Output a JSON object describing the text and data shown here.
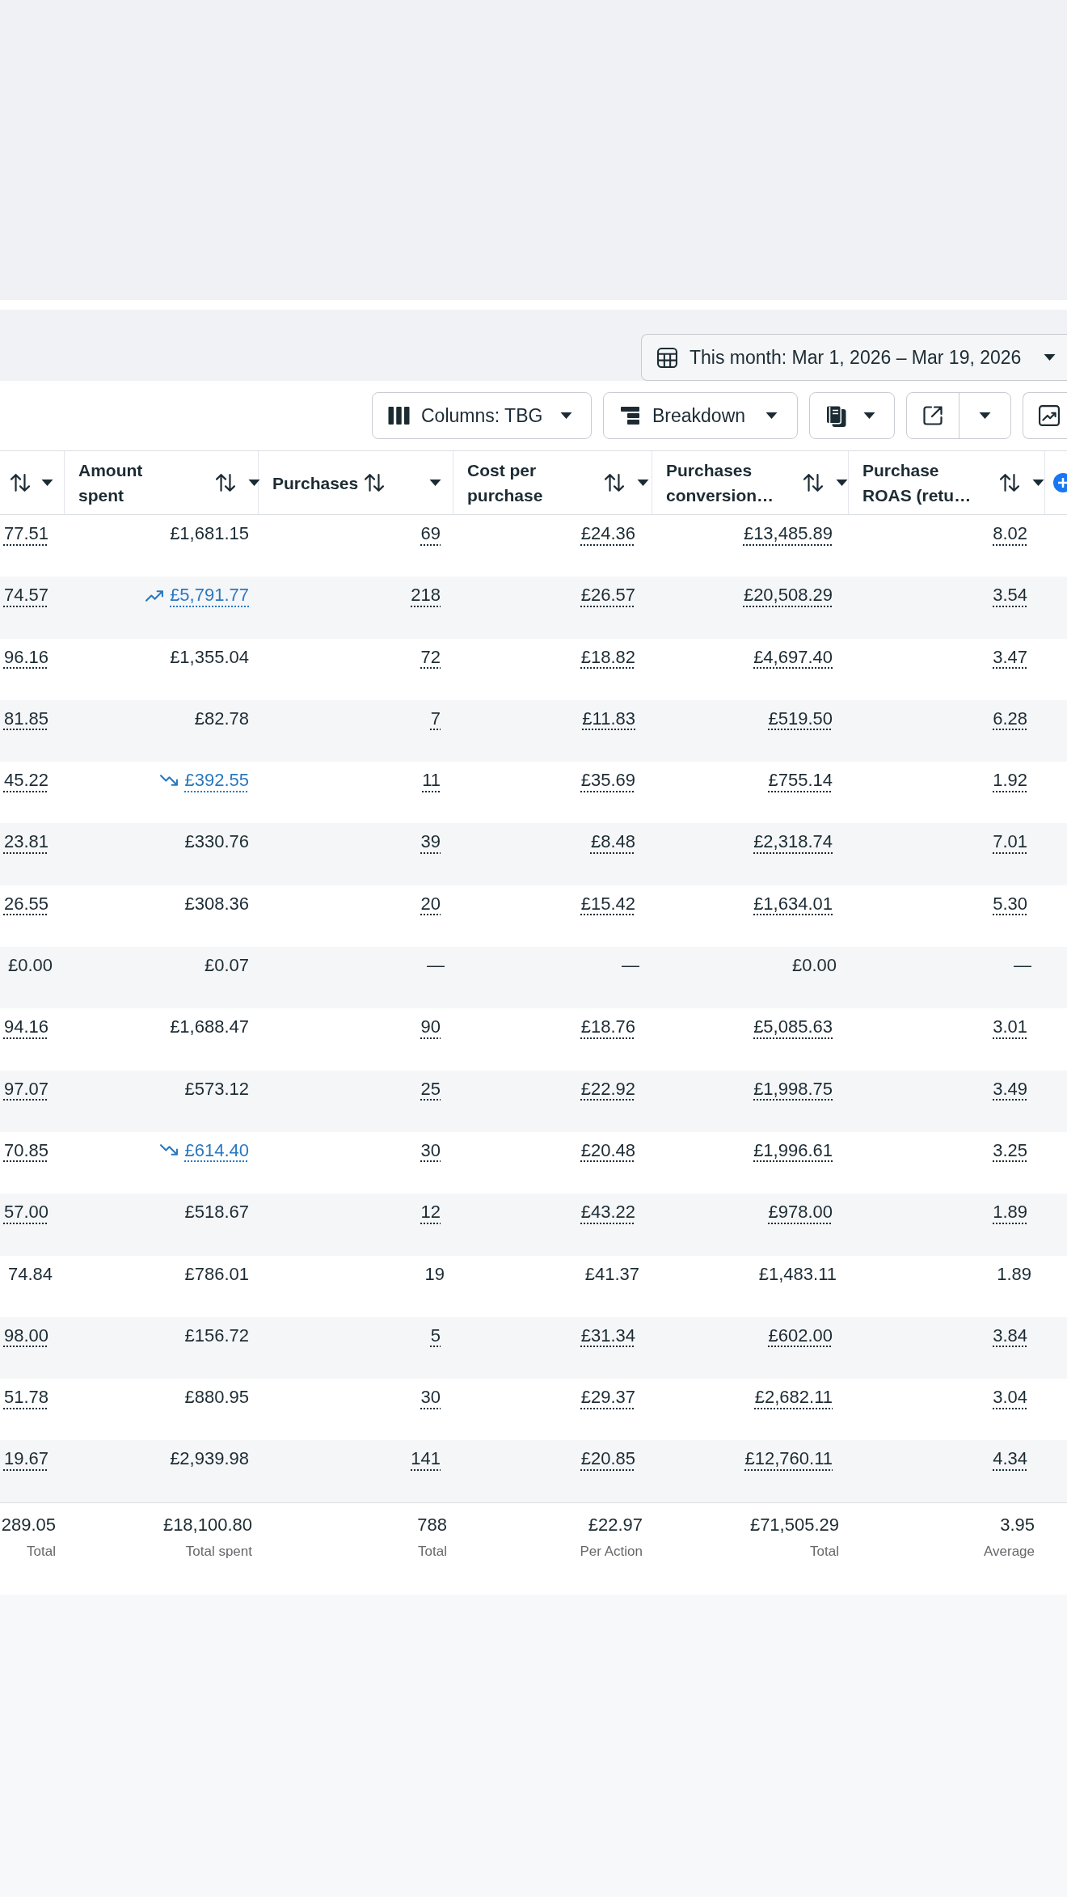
{
  "date_picker": {
    "label": "This month: Mar 1, 2026 – Mar 19, 2026"
  },
  "toolbar": {
    "columns_button": "Columns: TBG",
    "breakdown_button": "Breakdown"
  },
  "table": {
    "columns": [
      {
        "kind": "unlabeled"
      },
      {
        "kind": "stacked",
        "label": "Amount spent"
      },
      {
        "kind": "inline",
        "label": "Purchases"
      },
      {
        "kind": "stacked",
        "label": "Cost per purchase"
      },
      {
        "kind": "stacked",
        "label": "Purchases conversion…"
      },
      {
        "kind": "stacked",
        "label": "Purchase ROAS (retu…"
      }
    ],
    "rows": [
      {
        "kind": "plain",
        "linked": true,
        "column_1": "77.51",
        "amount_spent": "£1,681.15",
        "purchases": "69",
        "cost_per_purchase": "£24.36",
        "purchases_conversion": "£13,485.89",
        "purchase_roas": "8.02"
      },
      {
        "kind": "rising",
        "linked": true,
        "column_1": "74.57",
        "amount_spent": "£5,791.77",
        "purchases": "218",
        "cost_per_purchase": "£26.57",
        "purchases_conversion": "£20,508.29",
        "purchase_roas": "3.54"
      },
      {
        "kind": "plain",
        "linked": true,
        "column_1": "96.16",
        "amount_spent": "£1,355.04",
        "purchases": "72",
        "cost_per_purchase": "£18.82",
        "purchases_conversion": "£4,697.40",
        "purchase_roas": "3.47"
      },
      {
        "kind": "plain",
        "linked": true,
        "column_1": "81.85",
        "amount_spent": "£82.78",
        "purchases": "7",
        "cost_per_purchase": "£11.83",
        "purchases_conversion": "£519.50",
        "purchase_roas": "6.28"
      },
      {
        "kind": "falling",
        "linked": true,
        "column_1": "45.22",
        "amount_spent": "£392.55",
        "purchases": "11",
        "cost_per_purchase": "£35.69",
        "purchases_conversion": "£755.14",
        "purchase_roas": "1.92"
      },
      {
        "kind": "plain",
        "linked": true,
        "column_1": "23.81",
        "amount_spent": "£330.76",
        "purchases": "39",
        "cost_per_purchase": "£8.48",
        "purchases_conversion": "£2,318.74",
        "purchase_roas": "7.01"
      },
      {
        "kind": "plain",
        "linked": true,
        "column_1": "26.55",
        "amount_spent": "£308.36",
        "purchases": "20",
        "cost_per_purchase": "£15.42",
        "purchases_conversion": "£1,634.01",
        "purchase_roas": "5.30"
      },
      {
        "kind": "plain",
        "linked": false,
        "column_1": "£0.00",
        "amount_spent": "£0.07",
        "purchases": "—",
        "cost_per_purchase": "—",
        "purchases_conversion": "£0.00",
        "purchase_roas": "—"
      },
      {
        "kind": "plain",
        "linked": true,
        "column_1": "94.16",
        "amount_spent": "£1,688.47",
        "purchases": "90",
        "cost_per_purchase": "£18.76",
        "purchases_conversion": "£5,085.63",
        "purchase_roas": "3.01"
      },
      {
        "kind": "plain",
        "linked": true,
        "column_1": "97.07",
        "amount_spent": "£573.12",
        "purchases": "25",
        "cost_per_purchase": "£22.92",
        "purchases_conversion": "£1,998.75",
        "purchase_roas": "3.49"
      },
      {
        "kind": "falling",
        "linked": true,
        "column_1": "70.85",
        "amount_spent": "£614.40",
        "purchases": "30",
        "cost_per_purchase": "£20.48",
        "purchases_conversion": "£1,996.61",
        "purchase_roas": "3.25"
      },
      {
        "kind": "plain",
        "linked": true,
        "column_1": "57.00",
        "amount_spent": "£518.67",
        "purchases": "12",
        "cost_per_purchase": "£43.22",
        "purchases_conversion": "£978.00",
        "purchase_roas": "1.89"
      },
      {
        "kind": "plain",
        "linked": false,
        "column_1": "74.84",
        "amount_spent": "£786.01",
        "purchases": "19",
        "cost_per_purchase": "£41.37",
        "purchases_conversion": "£1,483.11",
        "purchase_roas": "1.89"
      },
      {
        "kind": "plain",
        "linked": true,
        "column_1": "98.00",
        "amount_spent": "£156.72",
        "purchases": "5",
        "cost_per_purchase": "£31.34",
        "purchases_conversion": "£602.00",
        "purchase_roas": "3.84"
      },
      {
        "kind": "plain",
        "linked": true,
        "column_1": "51.78",
        "amount_spent": "£880.95",
        "purchases": "30",
        "cost_per_purchase": "£29.37",
        "purchases_conversion": "£2,682.11",
        "purchase_roas": "3.04"
      },
      {
        "kind": "plain",
        "linked": true,
        "column_1": "19.67",
        "amount_spent": "£2,939.98",
        "purchases": "141",
        "cost_per_purchase": "£20.85",
        "purchases_conversion": "£12,760.11",
        "purchase_roas": "4.34"
      }
    ],
    "totals": [
      {
        "value": "289.05",
        "label": "Total"
      },
      {
        "value": "£18,100.80",
        "label": "Total spent"
      },
      {
        "value": "788",
        "label": "Total"
      },
      {
        "value": "£22.97",
        "label": "Per Action"
      },
      {
        "value": "£71,505.29",
        "label": "Total"
      },
      {
        "value": "3.95",
        "label": "Average"
      }
    ]
  }
}
